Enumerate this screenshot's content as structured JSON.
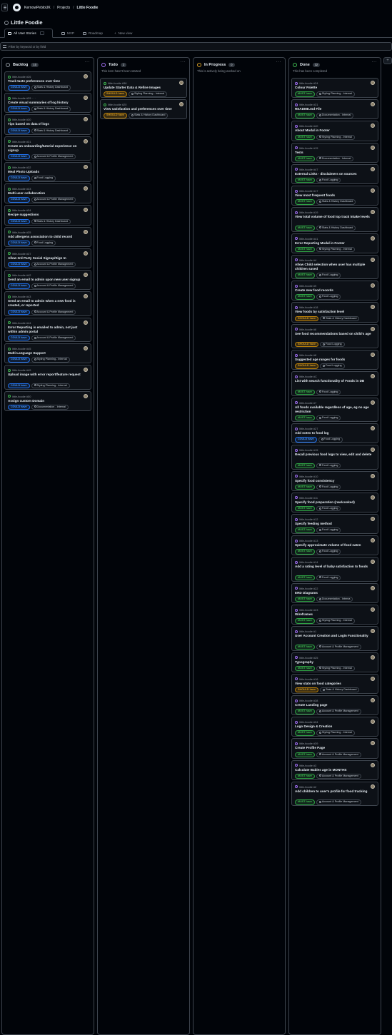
{
  "breadcrumbs": [
    "KernowPebloUK",
    "Projects",
    "Little Foodie"
  ],
  "project_title": "Little Foodie",
  "views": [
    {
      "label": "All User Stories",
      "active": true
    },
    {
      "label": "MVP",
      "active": false
    },
    {
      "label": "Roadmap",
      "active": false
    }
  ],
  "new_view_label": "New view",
  "filter_placeholder": "Filter by keyword or by field",
  "add_column_label": "+",
  "columns": [
    {
      "name": "Backlog",
      "count": "15",
      "description": "",
      "status_color": "#9198a1",
      "cards": [
        {
          "ref": "little-foodie #26",
          "title": "Track taste preferences over time",
          "labels": [
            {
              "text": "COULD have",
              "kind": "could"
            },
            {
              "text": "Stats & History Dashboard",
              "kind": "project"
            }
          ]
        },
        {
          "ref": "little-foodie #29 · · ·",
          "title": "Create visual summaries of log history",
          "labels": [
            {
              "text": "COULD have",
              "kind": "could"
            },
            {
              "text": "Stats & History Dashboard",
              "kind": "project"
            }
          ]
        },
        {
          "ref": "little-foodie #30",
          "title": "Tips based on data of logs",
          "labels": [
            {
              "text": "COULD have",
              "kind": "could"
            },
            {
              "text": "Stats & History Dashboard",
              "kind": "project"
            }
          ]
        },
        {
          "ref": "little-foodie #31",
          "title": "Create an onboarding/tutorial experience on signup",
          "labels": [
            {
              "text": "COULD have",
              "kind": "could"
            },
            {
              "text": "Account & Profile Management",
              "kind": "project"
            }
          ]
        },
        {
          "ref": "little-foodie #32",
          "title": "Meal Photo Uploads",
          "labels": [
            {
              "text": "COULD have",
              "kind": "could"
            },
            {
              "text": "Food Logging",
              "kind": "project"
            }
          ]
        },
        {
          "ref": "little-foodie #33",
          "title": "Multi-user collaboration",
          "labels": [
            {
              "text": "COULD have",
              "kind": "could"
            },
            {
              "text": "Account & Profile Management",
              "kind": "project"
            }
          ]
        },
        {
          "ref": "little-foodie #34",
          "title": "Recipe suggestions",
          "labels": [
            {
              "text": "COULD have",
              "kind": "could"
            },
            {
              "text": "Stats & History Dashboard",
              "kind": "project"
            }
          ]
        },
        {
          "ref": "little-foodie #35",
          "title": "Add allergens association to child record",
          "labels": [
            {
              "text": "COULD have",
              "kind": "could"
            },
            {
              "text": "Food Logging",
              "kind": "project"
            }
          ]
        },
        {
          "ref": "little-foodie #37",
          "title": "Allow 3rd Party Social Signup/Sign In",
          "labels": [
            {
              "text": "COULD have",
              "kind": "could"
            },
            {
              "text": "Account & Profile Management",
              "kind": "project"
            }
          ]
        },
        {
          "ref": "little-foodie #42",
          "title": "Send an email to admin upon new user signup",
          "labels": [
            {
              "text": "COULD have",
              "kind": "could"
            },
            {
              "text": "Account & Profile Management",
              "kind": "project"
            }
          ]
        },
        {
          "ref": "little-foodie #43",
          "title": "Send an email to admin when a new food is created, or reported",
          "labels": [
            {
              "text": "COULD have",
              "kind": "could"
            },
            {
              "text": "Account & Profile Management",
              "kind": "project"
            }
          ]
        },
        {
          "ref": "little-foodie #44",
          "title": "Error Reporting is emailed to admin, not just within admin portal",
          "labels": [
            {
              "text": "COULD have",
              "kind": "could"
            },
            {
              "text": "Account & Profile Management",
              "kind": "project"
            }
          ]
        },
        {
          "ref": "little-foodie #45",
          "title": "Multi-Language Support",
          "labels": [
            {
              "text": "COULD have",
              "kind": "could"
            },
            {
              "text": "Styling Planning - Internal",
              "kind": "project"
            }
          ]
        },
        {
          "ref": "little-foodie #49",
          "title": "Upload image with error report/feature request",
          "labels": [
            {
              "text": "COULD have",
              "kind": "could"
            },
            {
              "text": "Styling Planning - Internal",
              "kind": "project"
            }
          ]
        },
        {
          "ref": "little-foodie #50",
          "title": "Assign custom Domain",
          "labels": [
            {
              "text": "COULD have",
              "kind": "could"
            },
            {
              "text": "Documentation - Internal",
              "kind": "project"
            }
          ]
        }
      ]
    },
    {
      "name": "Todo",
      "count": "2",
      "description": "This item hasn't been started",
      "status_color": "#a371f7",
      "cards": [
        {
          "ref": "little-foodie #36",
          "title": "Update Starter Data & Refine Images",
          "labels": [
            {
              "text": "SHOULD have",
              "kind": "should"
            },
            {
              "text": "Styling Planning - Internal",
              "kind": "project"
            }
          ]
        },
        {
          "ref": "little-foodie #20",
          "title": "View satisfaction and preferences over time",
          "labels": [
            {
              "text": "SHOULD have",
              "kind": "should"
            },
            {
              "text": "Stats & History Dashboard",
              "kind": "project"
            }
          ]
        }
      ]
    },
    {
      "name": "In Progress",
      "count": "0",
      "description": "This is actively being worked on",
      "status_color": "#d29922",
      "cards": []
    },
    {
      "name": "Done",
      "count": "32",
      "description": "This has been completed",
      "status_color": "#3fb950",
      "cards": [
        {
          "ref": "little-foodie #24",
          "title": "Colour Palette",
          "labels": [
            {
              "text": "MUST have",
              "kind": "must"
            },
            {
              "text": "Styling Planning - Internal",
              "kind": "project"
            }
          ]
        },
        {
          "ref": "little-foodie #31",
          "title": "README.md File",
          "labels": [
            {
              "text": "MUST have",
              "kind": "must"
            },
            {
              "text": "Documentation - Internal",
              "kind": "project"
            }
          ]
        },
        {
          "ref": "little-foodie #40",
          "title": "About Modal in Footer",
          "labels": [
            {
              "text": "MUST have",
              "kind": "must"
            },
            {
              "text": "Styling Planning - Internal",
              "kind": "project"
            }
          ]
        },
        {
          "ref": "little-foodie #15",
          "title": "Tests",
          "labels": [
            {
              "text": "MUST have",
              "kind": "must"
            },
            {
              "text": "Documentation - Internal",
              "kind": "project"
            }
          ]
        },
        {
          "ref": "little-foodie #47",
          "title": "External Links - disclaimers on sources",
          "labels": [
            {
              "text": "MUST have",
              "kind": "must"
            },
            {
              "text": "Food Logging",
              "kind": "project"
            }
          ]
        },
        {
          "ref": "little-foodie #17",
          "title": "View most frequent foods",
          "labels": [
            {
              "text": "MUST have",
              "kind": "must"
            },
            {
              "text": "Stats & History Dashboard",
              "kind": "project"
            }
          ]
        },
        {
          "ref": "little-foodie #19",
          "title": "View total volume of food top track intake levels",
          "labels": [
            {
              "text": "MUST have",
              "kind": "must"
            },
            {
              "text": "Stats & History Dashboard",
              "kind": "project"
            }
          ]
        },
        {
          "ref": "little-foodie #41",
          "title": "Error Reporting Modal in Footer",
          "labels": [
            {
              "text": "MUST have",
              "kind": "must"
            },
            {
              "text": "Styling Planning - Internal",
              "kind": "project"
            }
          ]
        },
        {
          "ref": "little-foodie #4",
          "title": "Allow Child selection when user has multiple children saved",
          "labels": [
            {
              "text": "MUST have",
              "kind": "must"
            },
            {
              "text": "Food Logging",
              "kind": "project"
            }
          ]
        },
        {
          "ref": "little-foodie #9",
          "title": "Create new food records",
          "labels": [
            {
              "text": "MUST have",
              "kind": "must"
            },
            {
              "text": "Food Logging",
              "kind": "project"
            }
          ]
        },
        {
          "ref": "little-foodie #18",
          "title": "View foods by satisfaction level",
          "labels": [
            {
              "text": "SHOULD have",
              "kind": "should"
            },
            {
              "text": "Stats & History Dashboard",
              "kind": "project"
            }
          ]
        },
        {
          "ref": "little-foodie #6",
          "title": "See food recommendations based on child's age",
          "labels": [
            {
              "text": "SHOULD have",
              "kind": "should"
            },
            {
              "text": "Food Logging",
              "kind": "project"
            }
          ]
        },
        {
          "ref": "little-foodie #8",
          "title": "Suggested age ranges for foods",
          "labels": [
            {
              "text": "SHOULD have",
              "kind": "should"
            },
            {
              "text": "Food Logging",
              "kind": "project"
            }
          ]
        },
        {
          "ref": "little-foodie #C",
          "title": "List with search functionality of Foods in DB",
          "labels": [
            {
              "text": "MUST have",
              "kind": "must"
            },
            {
              "text": "Food Logging",
              "kind": "project"
            }
          ]
        },
        {
          "ref": "little-foodie #7",
          "title": "All foods available regardless of age, eg no age restriction",
          "labels": [
            {
              "text": "MUST have",
              "kind": "must"
            },
            {
              "text": "Food Logging",
              "kind": "project"
            }
          ]
        },
        {
          "ref": "little-foodie #27",
          "title": "Add notes to food log",
          "labels": [
            {
              "text": "COULD have",
              "kind": "could"
            },
            {
              "text": "Food Logging",
              "kind": "project"
            }
          ]
        },
        {
          "ref": "little-foodie #15",
          "title": "Recall previous food logs to view, edit and delete",
          "labels": [
            {
              "text": "MUST have",
              "kind": "must"
            },
            {
              "text": "Food Logging",
              "kind": "project"
            }
          ]
        },
        {
          "ref": "little-foodie #10",
          "title": "Specify food consistency",
          "labels": [
            {
              "text": "MUST have",
              "kind": "must"
            },
            {
              "text": "Food Logging",
              "kind": "project"
            }
          ]
        },
        {
          "ref": "little-foodie #11",
          "title": "Specify food preparation (raw/cooked)",
          "labels": [
            {
              "text": "MUST have",
              "kind": "must"
            },
            {
              "text": "Food Logging",
              "kind": "project"
            }
          ]
        },
        {
          "ref": "little-foodie #12",
          "title": "Specify feeding method",
          "labels": [
            {
              "text": "MUST have",
              "kind": "must"
            },
            {
              "text": "Food Logging",
              "kind": "project"
            }
          ]
        },
        {
          "ref": "little-foodie #13",
          "title": "Specify approximate volume of food eaten",
          "labels": [
            {
              "text": "MUST have",
              "kind": "must"
            },
            {
              "text": "Food Logging",
              "kind": "project"
            }
          ]
        },
        {
          "ref": "little-foodie #14",
          "title": "Add a rating level of baby satisfaction to foods",
          "labels": [
            {
              "text": "MUST have",
              "kind": "must"
            },
            {
              "text": "Food Logging",
              "kind": "project"
            }
          ]
        },
        {
          "ref": "little-foodie #22",
          "title": "ERD Diagrams",
          "labels": [
            {
              "text": "MUST have",
              "kind": "must"
            },
            {
              "text": "Documentation - Interna",
              "kind": "project"
            }
          ]
        },
        {
          "ref": "little-foodie #23",
          "title": "Wireframes",
          "labels": [
            {
              "text": "MUST have",
              "kind": "must"
            },
            {
              "text": "Styling Planning - Internal",
              "kind": "project"
            }
          ]
        },
        {
          "ref": "little-foodie #1",
          "title": "User Account Creation and Login Functionality",
          "labels": [
            {
              "text": "MUST have",
              "kind": "must"
            },
            {
              "text": "Account & Profile Management",
              "kind": "project"
            }
          ]
        },
        {
          "ref": "little-foodie #25",
          "title": "Typography",
          "labels": [
            {
              "text": "MUST have",
              "kind": "must"
            },
            {
              "text": "Styling Planning - Internal",
              "kind": "project"
            }
          ]
        },
        {
          "ref": "little-foodie #16",
          "title": "View stats on food categories",
          "labels": [
            {
              "text": "SHOULD have",
              "kind": "should"
            },
            {
              "text": "Stats & History Dashboard",
              "kind": "project"
            }
          ]
        },
        {
          "ref": "little-foodie #38",
          "title": "Create Landing page",
          "labels": [
            {
              "text": "MUST have",
              "kind": "must"
            },
            {
              "text": "Account & Profile Management",
              "kind": "project"
            }
          ]
        },
        {
          "ref": "little-foodie #34",
          "title": "Logo Design & Creation",
          "labels": [
            {
              "text": "MUST have",
              "kind": "must"
            },
            {
              "text": "Styling Planning - Internal",
              "kind": "project"
            }
          ]
        },
        {
          "ref": "little-foodie #39",
          "title": "Create Profile Page",
          "labels": [
            {
              "text": "MUST have",
              "kind": "must"
            },
            {
              "text": "Account & Profile Management",
              "kind": "project"
            }
          ]
        },
        {
          "ref": "little-foodie #3",
          "title": "Calculate Babies age in MONTHS",
          "labels": [
            {
              "text": "MUST have",
              "kind": "must"
            },
            {
              "text": "Account & Profile Management",
              "kind": "project"
            }
          ]
        },
        {
          "ref": "little-foodie #2",
          "title": "Add children to user's profile for food tracking",
          "labels": [
            {
              "text": "MUST have",
              "kind": "must"
            },
            {
              "text": "Account & Profile Management",
              "kind": "project"
            }
          ]
        }
      ]
    }
  ]
}
